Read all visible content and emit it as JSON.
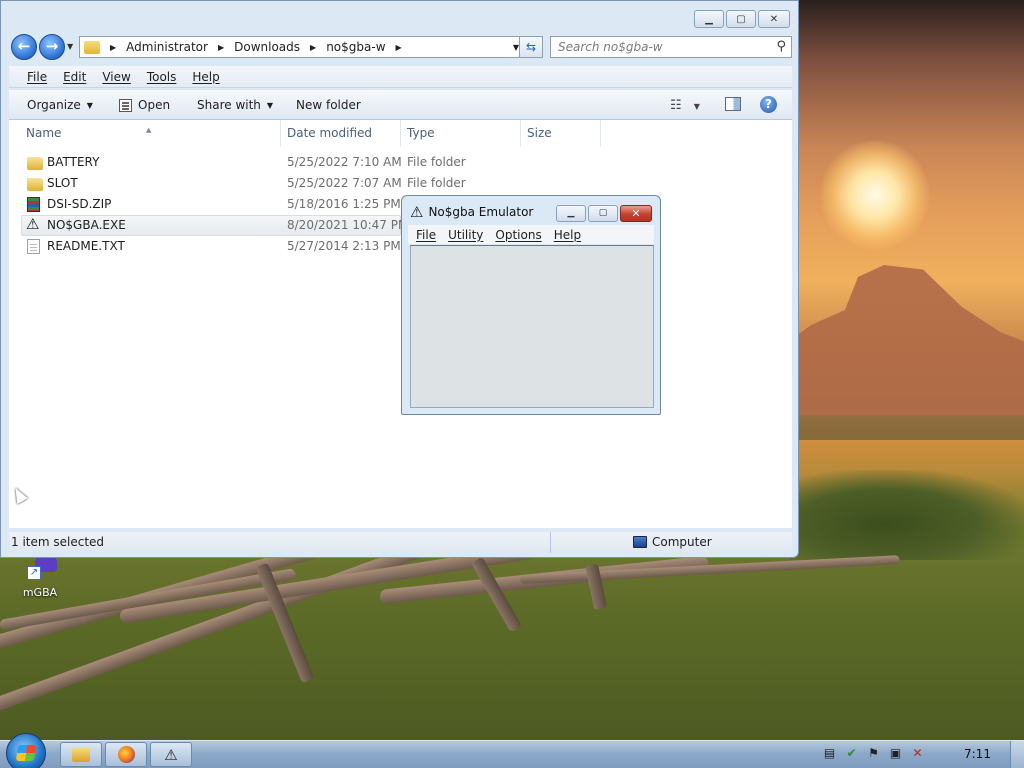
{
  "desktop": {
    "icons": [
      {
        "label": "mGBA",
        "icon": "mgba-shortcut-icon"
      }
    ]
  },
  "explorer": {
    "breadcrumb": [
      "Administrator",
      "Downloads",
      "no$gba-w"
    ],
    "search_placeholder": "Search no$gba-w",
    "menu": [
      "File",
      "Edit",
      "View",
      "Tools",
      "Help"
    ],
    "commands": {
      "organize": "Organize",
      "open": "Open",
      "share": "Share with",
      "new_folder": "New folder"
    },
    "columns": {
      "name": "Name",
      "date": "Date modified",
      "type": "Type",
      "size": "Size"
    },
    "files": [
      {
        "name": "BATTERY",
        "date": "5/25/2022 7:10 AM",
        "type": "File folder",
        "icon": "folder-icon"
      },
      {
        "name": "SLOT",
        "date": "5/25/2022 7:07 AM",
        "type": "File folder",
        "icon": "folder-icon"
      },
      {
        "name": "DSI-SD.ZIP",
        "date": "5/18/2016 1:25 PM",
        "type": "",
        "icon": "zip-archive-icon"
      },
      {
        "name": "NO$GBA.EXE",
        "date": "8/20/2021 10:47 PM",
        "type": "",
        "icon": "nogba-exe-icon",
        "selected": true
      },
      {
        "name": "README.TXT",
        "date": "5/27/2014 2:13 PM",
        "type": "",
        "icon": "text-file-icon"
      }
    ],
    "status": {
      "selection": "1 item selected",
      "location": "Computer"
    }
  },
  "nogba": {
    "title": "No$gba Emulator",
    "menu": [
      "File",
      "Utility",
      "Options",
      "Help"
    ]
  },
  "taskbar": {
    "clock": "7:11",
    "pinned": [
      "explorer-icon",
      "firefox-icon",
      "nogba-icon"
    ]
  },
  "colors": {
    "accent": "#2a6fd1",
    "close_red": "#c7402e",
    "selection": "#e6eaee"
  }
}
